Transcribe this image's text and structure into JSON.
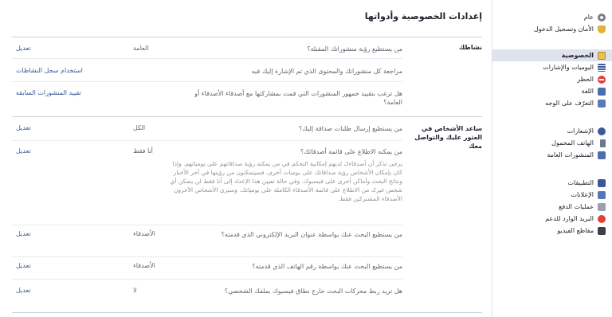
{
  "page": {
    "title": "إعدادات الخصوصية وأدواتها"
  },
  "sidebar": {
    "groups": [
      [
        {
          "label": "عام",
          "icon": "gear-icon"
        },
        {
          "label": "الأمان وتسجيل الدخول",
          "icon": "shield-icon"
        }
      ],
      [
        {
          "label": "الخصوصية",
          "icon": "lock-icon",
          "selected": true
        },
        {
          "label": "اليوميات والإشارات",
          "icon": "timeline-icon"
        },
        {
          "label": "الحظر",
          "icon": "block-icon"
        },
        {
          "label": "اللغة",
          "icon": "language-icon"
        },
        {
          "label": "التعرّف على الوجه",
          "icon": "face-recognition-icon"
        }
      ],
      [
        {
          "label": "الإشعارات",
          "icon": "globe-icon"
        },
        {
          "label": "الهاتف المحمول",
          "icon": "mobile-phone-icon"
        },
        {
          "label": "المنشورات العامة",
          "icon": "rss-icon"
        }
      ],
      [
        {
          "label": "التطبيقات",
          "icon": "apps-icon"
        },
        {
          "label": "الإعلانات",
          "icon": "ads-icon"
        },
        {
          "label": "عمليات الدفع",
          "icon": "payments-icon"
        },
        {
          "label": "البريد الوارد للدعم",
          "icon": "support-inbox-icon"
        },
        {
          "label": "مقاطع الفيديو",
          "icon": "video-icon"
        }
      ]
    ]
  },
  "sections": [
    {
      "label": "نشاطك",
      "rows": [
        {
          "question": "من يستطيع رؤية منشوراتك المقبلة؟",
          "value": "العامة",
          "action": "تعديل"
        },
        {
          "question": "مراجعة كل منشوراتك والمحتوى الذي تم الإشارة إليك فيه",
          "value": "",
          "action": "استخدام سجل النشاطات"
        },
        {
          "question": "هل ترغب بتقييد جمهور المنشورات التي قمت بمشاركتها مع أصدقاء الأصدقاء أو العامة؟",
          "value": "",
          "action": "تقييد المنشورات السابقة"
        }
      ]
    },
    {
      "label": "ساعد الأشخاص في العثور عليك والتواصل معك",
      "rows": [
        {
          "question": "من يستطيع إرسال طلبات صداقة إليك؟",
          "value": "الكل",
          "action": "تعديل"
        },
        {
          "question": "من يمكنه الاطلاع على قائمة أصدقائك؟",
          "value": "أنا فقط",
          "action": "تعديل",
          "description": "يرجى تذكر أن أصدقاءك لديهم إمكانية التحكم في من يمكنه رؤية صداقاتهم على يومياتهم. وإذا كان بإمكان الأشخاص رؤية صداقاتك على يوميات أخرى، فسيتمكنون من رؤيتها في آخر الأخبار ونتائج البحث وأماكن أخرى على فيسبوك. وفي حالة تعيين هذا الإعداد إلى أنا فقط لن يتمكن أي شخص غيرك من الاطلاع على قائمة الأصدقاء الكاملة على يومياتك. وسيرى الأشخاص الآخرون الأصدقاء المشتركين فقط."
        },
        {
          "question": "من يستطيع البحث عنك بواسطة عنوان البريد الإلكتروني الذي قدمته؟",
          "value": "الأصدقاء",
          "action": "تعديل"
        },
        {
          "question": "من يستطيع البحث عنك بواسطة رقم الهاتف الذي قدمته؟",
          "value": "الأصدقاء",
          "action": "تعديل"
        },
        {
          "question": "هل تريد ربط محركات البحث خارج نطاق فيسبوك بملفك الشخصي؟",
          "value": "لا",
          "action": "تعديل"
        }
      ]
    }
  ]
}
